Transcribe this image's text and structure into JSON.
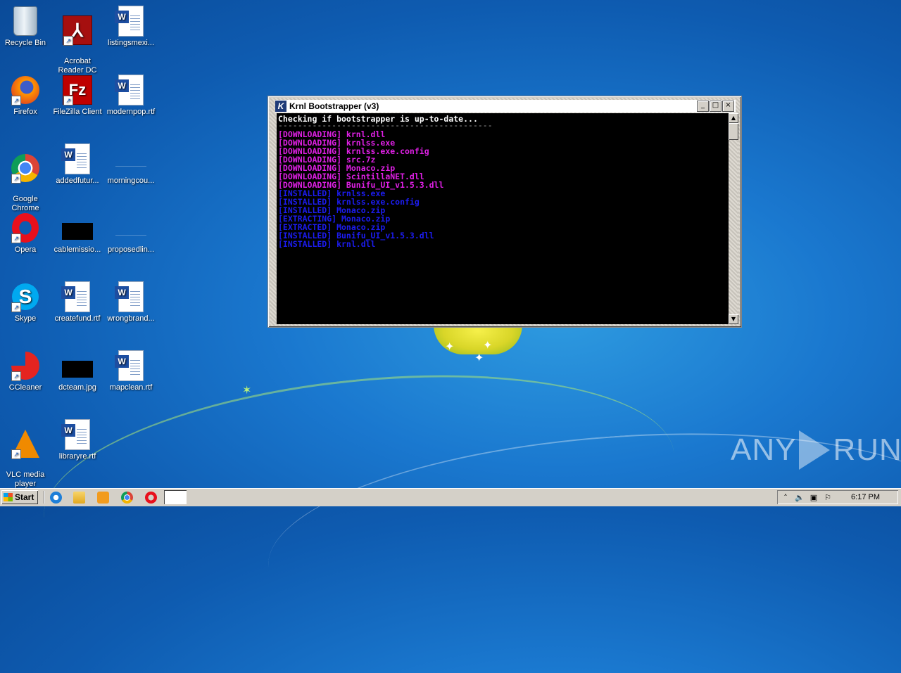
{
  "desktop": {
    "icons": [
      {
        "label": "Recycle Bin"
      },
      {
        "label": "Acrobat\nReader DC"
      },
      {
        "label": "listingsmexi..."
      },
      {
        "label": "Firefox"
      },
      {
        "label": "FileZilla Client"
      },
      {
        "label": "modernpop.rtf"
      },
      {
        "label": "Google\nChrome"
      },
      {
        "label": "addedfutur..."
      },
      {
        "label": "morningcou..."
      },
      {
        "label": "Opera"
      },
      {
        "label": "cablemissio..."
      },
      {
        "label": "proposedlin..."
      },
      {
        "label": "Skype"
      },
      {
        "label": "createfund.rtf"
      },
      {
        "label": "wrongbrand..."
      },
      {
        "label": "CCleaner"
      },
      {
        "label": "dcteam.jpg"
      },
      {
        "label": "mapclean.rtf"
      },
      {
        "label": "VLC media\nplayer"
      },
      {
        "label": "libraryre.rtf"
      }
    ]
  },
  "window": {
    "title": "Krnl Bootstrapper (v3)",
    "icon_letter": "K",
    "buttons": {
      "minimize": "_",
      "maximize": "□",
      "close": "×"
    },
    "console": {
      "header": "Checking if bootstrapper is up-to-date...",
      "separator": "--------------------------------------------",
      "lines": [
        {
          "text": "[DOWNLOADING] krnl.dll",
          "color": "magenta"
        },
        {
          "text": "[DOWNLOADING] krnlss.exe",
          "color": "magenta"
        },
        {
          "text": "[DOWNLOADING] krnlss.exe.config",
          "color": "magenta"
        },
        {
          "text": "[DOWNLOADING] src.7z",
          "color": "magenta"
        },
        {
          "text": "[DOWNLOADING] Monaco.zip",
          "color": "magenta"
        },
        {
          "text": "[DOWNLOADING] ScintillaNET.dll",
          "color": "magenta"
        },
        {
          "text": "[DOWNLOADING] Bunifu_UI_v1.5.3.dll",
          "color": "magenta"
        },
        {
          "text": "[INSTALLED] krnlss.exe",
          "color": "blue"
        },
        {
          "text": "[INSTALLED] krnlss.exe.config",
          "color": "blue"
        },
        {
          "text": "[INSTALLED] Monaco.zip",
          "color": "blue"
        },
        {
          "text": "[EXTRACTING] Monaco.zip",
          "color": "blue"
        },
        {
          "text": "[EXTRACTED] Monaco.zip",
          "color": "blue"
        },
        {
          "text": "[INSTALLED] Bunifu_UI_v1.5.3.dll",
          "color": "blue"
        },
        {
          "text": "[INSTALLED] krnl.dll",
          "color": "blue"
        }
      ]
    },
    "colors": {
      "magenta": "#e020e6",
      "blue": "#1c1cf0",
      "white": "#ffffff"
    }
  },
  "taskbar": {
    "start_label": "Start",
    "pinned": [
      "internet-explorer-icon",
      "folder-icon",
      "media-player-icon",
      "chrome-icon",
      "opera-icon"
    ],
    "tray_icons": [
      "expand-tray-icon",
      "volume-icon",
      "network-icon",
      "flag-icon"
    ],
    "tray_glyphs": {
      "expand": "˄",
      "volume": "🔈",
      "network": "▣",
      "flag": "⚐"
    },
    "clock": "6:17 PM"
  },
  "watermark": {
    "left": "ANY",
    "right": "RUN"
  }
}
